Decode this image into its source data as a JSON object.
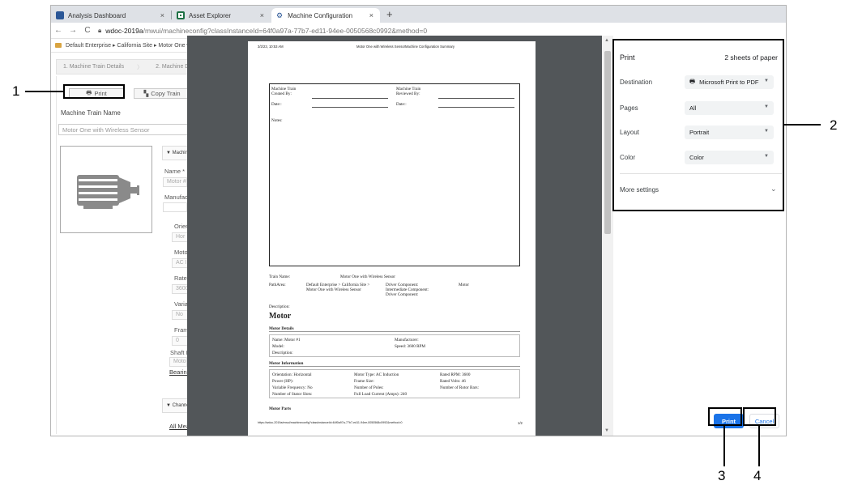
{
  "tabs": [
    {
      "label": "Analysis Dashboard",
      "color": "#2b5797"
    },
    {
      "label": "Asset Explorer",
      "color": "#1e7145"
    },
    {
      "label": "Machine Configuration",
      "color": "#2b5797"
    }
  ],
  "tab_close": "×",
  "new_tab": "+",
  "address": {
    "host": "wdoc-2019a",
    "path": "/mwui/machineconfig?classInstanceId=64f0a97a-77b7-ed11-94ee-0050568c0992&method=0"
  },
  "breadcrumb": "Default Enterprise ▸ California Site ▸ Motor One with W",
  "steps": [
    "1. Machine Train Details",
    "2. Machine Details"
  ],
  "toolbar": {
    "print": "Print",
    "copy": "Copy Train"
  },
  "machine_train_name": {
    "label": "Machine Train Name",
    "value": "Motor One with Wireless Sensor"
  },
  "section_machine": "▼ Machine",
  "fields": {
    "name_label": "Name *",
    "name_value": "Motor #",
    "manufacturer_label": "Manufact",
    "orientation_label": "Orien",
    "orientation_value": "Hor",
    "motor_type_label": "Moto",
    "motor_type_value": "AC I",
    "rated_label": "Ratec",
    "rated_value": "3600",
    "variable_label": "Varial",
    "variable_value": "No",
    "frame_label": "Frame",
    "frame_value": "0",
    "shaft_label": "Shaft I",
    "shaft_value": "Moto",
    "bearing_link": "Bearing"
  },
  "section_channels": "▼ Channe",
  "all_measurements": "All Mea",
  "preview": {
    "timestamp": "3/2/23, 10:53 AM",
    "header_title": "Motor One with Wireless SensorMachine Configuration Summary",
    "created_by_title": "Machine Train",
    "created_by": "Created By:",
    "reviewed_by_title": "Machine Train",
    "reviewed_by": "Reviewed By:",
    "date1": "Date::",
    "date2": "Date::",
    "notes": "Notes:",
    "train_name_label": "Train Name:",
    "train_name_value": "Motor One with Wireless Sensor",
    "patharea_label": "PathArea:",
    "patharea_value1": "Default Enterprise > California Site >",
    "patharea_value2": "Motor One with Wireless Sensor",
    "driver_component": "Driver Component:",
    "driver_component_value": "Motor",
    "intermediate_component": "Intermediate Component:",
    "driver_component2": "Driver Component:",
    "description_label": "Description:",
    "motor_heading": "Motor",
    "motor_details_heading": "Motor Details",
    "md_name": "Name: Motor #1",
    "md_model": "Model:",
    "md_description": "Description:",
    "md_manufacturer": "Manufacturer:",
    "md_speed": "Speed:    3600 RPM",
    "motor_info_heading": "Motor Information",
    "mi_orientation": "Orientation: Horizontal",
    "mi_power": "Power (HP):",
    "mi_variable": "Variable Frequency: No",
    "mi_stator": "Number of Stator Slots:",
    "mi_motor_type": "Motor Type:  AC Induction",
    "mi_frame": "Frame Size:",
    "mi_poles": "Number of Poles:",
    "mi_flc": "Full Load Current (Amps): 240",
    "mi_rpm": "Rated RPM: 3600",
    "mi_volts": "Rated Volts: 46",
    "mi_rotor": "Number of Rotor Bars:",
    "motor_parts_heading": "Motor Parts",
    "footer_url": "https://wdoc-2019a/mwui/machineconfig?classInstanceId=64f0a97a-77b7-ed11-94ee-0050568c0992&method=0",
    "footer_page": "1/2"
  },
  "print_dialog": {
    "title": "Print",
    "sheets": "2 sheets of paper",
    "destination_label": "Destination",
    "destination_value": "Microsoft Print to PDF",
    "pages_label": "Pages",
    "pages_value": "All",
    "layout_label": "Layout",
    "layout_value": "Portrait",
    "color_label": "Color",
    "color_value": "Color",
    "more_settings": "More settings",
    "print_button": "Print",
    "cancel_button": "Cancel",
    "accent": "#1a73e8"
  },
  "callouts": [
    "1",
    "2",
    "3",
    "4"
  ]
}
